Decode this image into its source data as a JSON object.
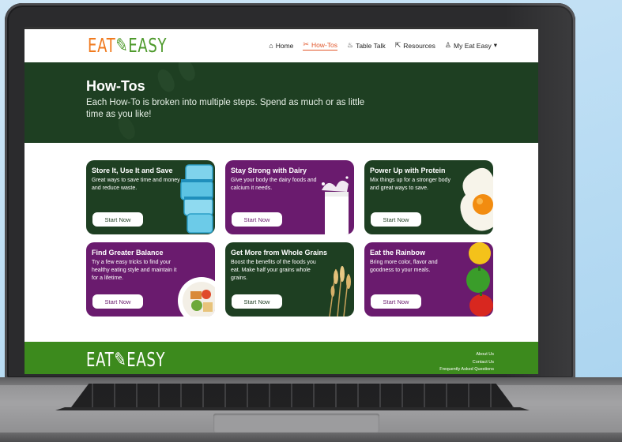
{
  "brand": {
    "logo_left": "EAT",
    "logo_right": "EASY",
    "colors": {
      "orange": "#f07a1e",
      "green": "#4e9a2c",
      "dark_green": "#1e3f22",
      "purple": "#6a1b6e",
      "footer_green": "#3c8a1d",
      "accent": "#e2572b"
    }
  },
  "nav": {
    "items": [
      {
        "label": "Home",
        "icon": "home-icon"
      },
      {
        "label": "How-Tos",
        "icon": "utensils-icon",
        "active": true
      },
      {
        "label": "Table Talk",
        "icon": "dining-icon"
      },
      {
        "label": "Resources",
        "icon": "external-link-icon"
      },
      {
        "label": "My Eat Easy",
        "icon": "user-icon",
        "caret": "▾"
      }
    ]
  },
  "hero": {
    "title": "How-Tos",
    "subtitle": "Each How-To is broken into multiple steps. Spend as much or as little time as you like!"
  },
  "cards": [
    {
      "title": "Store It, Use It and Save",
      "desc": "Great ways to save time and money and reduce waste.",
      "button": "Start Now",
      "theme": "green",
      "art": "food-containers-image"
    },
    {
      "title": "Stay Strong with Dairy",
      "desc": "Give your body the dairy foods and calcium it needs.",
      "button": "Start Now",
      "theme": "purple",
      "art": "milk-splash-image"
    },
    {
      "title": "Power Up with Protein",
      "desc": "Mix things up for a stronger body and great ways to save.",
      "button": "Start Now",
      "theme": "green",
      "art": "fried-egg-image"
    },
    {
      "title": "Find Greater Balance",
      "desc": "Try a few easy tricks to find your healthy eating style and maintain it for a lifetime.",
      "button": "Start Now",
      "theme": "purple",
      "art": "balanced-plate-image"
    },
    {
      "title": "Get More from Whole Grains",
      "desc": "Boost the benefits of the foods you eat. Make half your grains whole grains.",
      "button": "Start Now",
      "theme": "green",
      "art": "wheat-image"
    },
    {
      "title": "Eat the Rainbow",
      "desc": "Bring more color, flavor and goodness to your meals.",
      "button": "Start Now",
      "theme": "purple",
      "art": "bell-peppers-image"
    }
  ],
  "footer": {
    "logo_left": "EAT",
    "logo_right": "EASY",
    "links": [
      "About Us",
      "Contact Us",
      "Frequently Asked Questions"
    ]
  }
}
